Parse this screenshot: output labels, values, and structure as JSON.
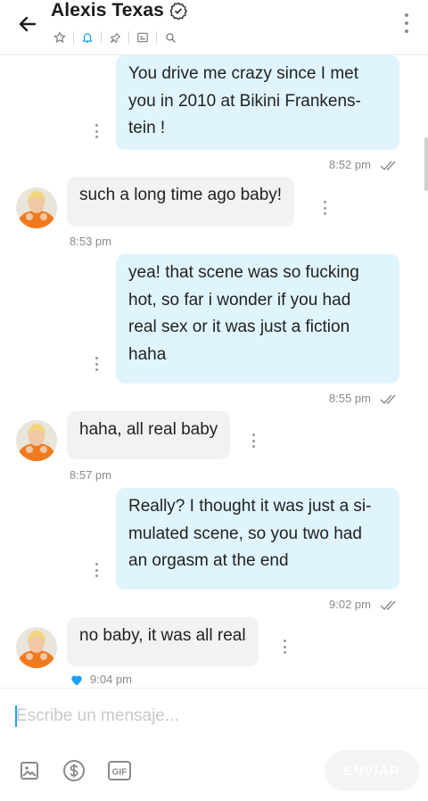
{
  "header": {
    "contact_name": "Alexis Texas"
  },
  "messages": [
    {
      "direction": "out",
      "lines": [
        "You drive me crazy since I met",
        "you in 2010 at Bikini Frankens-",
        "tein !"
      ],
      "time": "8:52 pm"
    },
    {
      "direction": "in",
      "lines": [
        "such a long time ago baby!"
      ],
      "time": "8:53 pm"
    },
    {
      "direction": "out",
      "lines": [
        "yea! that scene was so fucking",
        "hot, so far i wonder if you had",
        "real sex or it was just a fiction",
        "haha"
      ],
      "time": "8:55 pm"
    },
    {
      "direction": "in",
      "lines": [
        "haha, all real baby"
      ],
      "time": "8:57 pm"
    },
    {
      "direction": "out",
      "lines": [
        "Really? I thought it was just a si-",
        "mulated scene, so you two had",
        "an orgasm at the end"
      ],
      "time": "9:02 pm"
    },
    {
      "direction": "in",
      "lines": [
        "no baby, it was all real"
      ],
      "time": "9:04 pm",
      "liked": true
    }
  ],
  "composer": {
    "placeholder": "Escribe un mensaje...",
    "send_label": "ENVIAR",
    "gif_label": "GIF"
  },
  "colors": {
    "outgoing_bubble": "#dff4fd",
    "incoming_bubble": "#f2f2f2",
    "accent": "#1da1f2",
    "like_heart": "#1da1f2"
  }
}
